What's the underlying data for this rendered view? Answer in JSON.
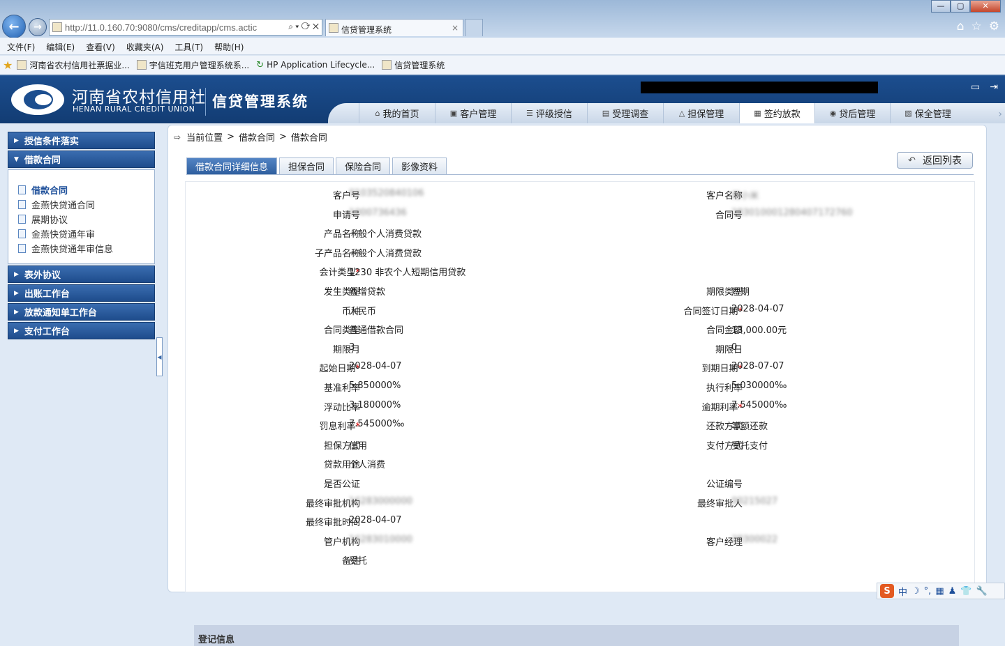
{
  "browser": {
    "url": "http://11.0.160.70:9080/cms/creditapp/cms.actic",
    "address_tools": "⌕ ▾ ⟳ ✕",
    "tab_title": "信贷管理系统",
    "tab_close": "×",
    "window_controls": [
      "—",
      "▢",
      "✕"
    ],
    "right_icons": [
      "home-icon",
      "star-icon",
      "gear-icon"
    ],
    "menu": [
      "文件(F)",
      "编辑(E)",
      "查看(V)",
      "收藏夹(A)",
      "工具(T)",
      "帮助(H)"
    ],
    "favorites": [
      "河南省农村信用社票据业...",
      "宇信班克用户管理系统系...",
      "HP Application Lifecycle...",
      "信贷管理系统"
    ]
  },
  "header": {
    "org_name": "河南省农村信用社",
    "org_name_en": "HENAN RURAL CREDIT UNION",
    "system_name": "信贷管理系统",
    "icons": [
      "monitor-icon",
      "logout-icon"
    ]
  },
  "nav": {
    "tabs": [
      {
        "label": "我的首页",
        "icon": "home-icon",
        "glyph": "⌂"
      },
      {
        "label": "客户管理",
        "icon": "customer-icon",
        "glyph": "▣"
      },
      {
        "label": "评级授信",
        "icon": "rating-icon",
        "glyph": "☰"
      },
      {
        "label": "受理调查",
        "icon": "survey-icon",
        "glyph": "▤"
      },
      {
        "label": "担保管理",
        "icon": "guarantee-icon",
        "glyph": "△"
      },
      {
        "label": "签约放款",
        "icon": "contract-icon",
        "glyph": "▦"
      },
      {
        "label": "贷后管理",
        "icon": "postloan-icon",
        "glyph": "◉"
      },
      {
        "label": "保全管理",
        "icon": "preservation-icon",
        "glyph": "▧"
      }
    ],
    "active_index": 5,
    "next_glyph": "›"
  },
  "sidebar": {
    "sections": [
      {
        "label": "授信条件落实",
        "expanded": false
      },
      {
        "label": "借款合同",
        "expanded": true
      }
    ],
    "sub_items": [
      "借款合同",
      "金燕快贷通合同",
      "展期协议",
      "金燕快贷通年审",
      "金燕快贷通年审信息"
    ],
    "active_sub_index": 0,
    "sections_after": [
      "表外协议",
      "出账工作台",
      "放款通知单工作台",
      "支付工作台"
    ]
  },
  "breadcrumb": {
    "label": "当前位置",
    "sep": ">",
    "items": [
      "借款合同",
      "借款合同"
    ]
  },
  "back_button": "返回列表",
  "tabs": [
    "借款合同详细信息",
    "担保合同",
    "保险合同",
    "影像资料"
  ],
  "active_tab": 0,
  "fields": [
    {
      "left": {
        "label": "客户号",
        "value": "0103520840106",
        "blur": true
      },
      "right": {
        "label": "客户名称",
        "value": "周小米",
        "blur": true
      }
    },
    {
      "left": {
        "label": "申请号",
        "value": "1000736436",
        "blur": true
      },
      "right": {
        "label": "合同号",
        "value": "283010001280407172760",
        "blur": true
      }
    },
    {
      "left": {
        "label": "产品名称",
        "value": "一般个人消费贷款"
      }
    },
    {
      "left": {
        "label": "子产品名称",
        "value": "一般个人消费贷款"
      }
    },
    {
      "left": {
        "label": "会计类型",
        "value": "1230 非农个人短期信用贷款",
        "required": true
      }
    },
    {
      "left": {
        "label": "发生类型",
        "value": "新增贷款"
      },
      "right": {
        "label": "期限类型",
        "value": "短期"
      }
    },
    {
      "left": {
        "label": "币种",
        "value": "人民币"
      },
      "right": {
        "label": "合同签订日期",
        "value": "2028-04-07",
        "required": true
      }
    },
    {
      "left": {
        "label": "合同类型",
        "value": "普通借款合同"
      },
      "right": {
        "label": "合同金额",
        "value": "13,000.00元"
      }
    },
    {
      "left": {
        "label": "期限月",
        "value": "3"
      },
      "right": {
        "label": "期限日",
        "value": "0"
      }
    },
    {
      "left": {
        "label": "起始日期",
        "value": "2028-04-07",
        "required": true
      },
      "right": {
        "label": "到期日期",
        "value": "2028-07-07",
        "required": true
      }
    },
    {
      "left": {
        "label": "基准利率",
        "value": "5.850000%"
      },
      "right": {
        "label": "执行利率",
        "value": "5.030000‰"
      }
    },
    {
      "left": {
        "label": "浮动比率",
        "value": "3.180000%"
      },
      "right": {
        "label": "逾期利率",
        "value": "7.545000‰",
        "required": true
      }
    },
    {
      "left": {
        "label": "罚息利率",
        "value": "7.545000‰",
        "required": true
      },
      "right": {
        "label": "还款方式",
        "value": "等额还款"
      }
    },
    {
      "left": {
        "label": "担保方式",
        "value": "信用"
      },
      "right": {
        "label": "支付方式",
        "value": "受托支付"
      }
    },
    {
      "left": {
        "label": "贷款用途",
        "value": "个人消费"
      }
    },
    {
      "left": {
        "label": "是否公证",
        "value": ""
      },
      "right": {
        "label": "公证编号",
        "value": ""
      }
    },
    {
      "left": {
        "label": "最终审批机构",
        "value": "16283000000",
        "blur": true
      },
      "right": {
        "label": "最终审批人",
        "value": "00215027",
        "blur": true
      }
    },
    {
      "left": {
        "label": "最终审批时间",
        "value": "2028-04-07"
      }
    },
    {
      "left": {
        "label": "管户机构",
        "value": "16283010000",
        "blur": true
      },
      "right": {
        "label": "客户经理",
        "value": "28300022",
        "blur": true
      }
    },
    {
      "left": {
        "label": "备注",
        "value": "受托"
      }
    }
  ],
  "section_register": "登记信息",
  "ime": {
    "logo": "S",
    "items": [
      "中",
      "☽",
      "°,",
      "▦",
      "♟",
      "👕",
      "🔧"
    ]
  }
}
